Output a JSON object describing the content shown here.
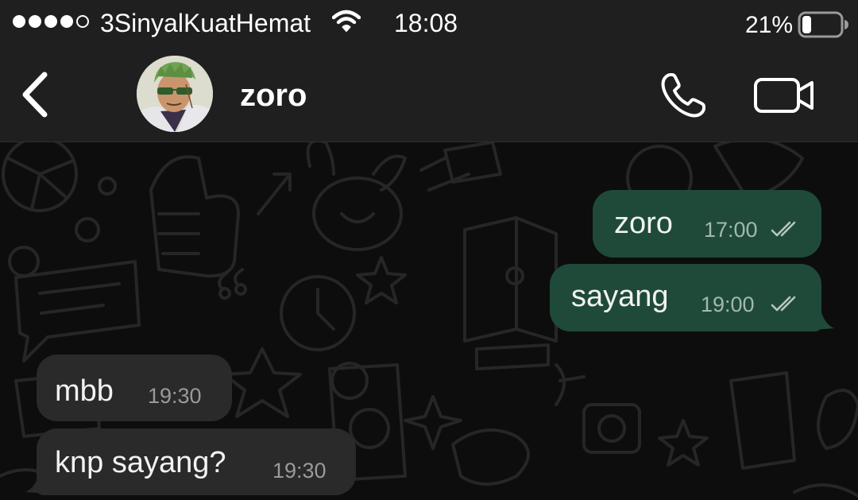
{
  "status_bar": {
    "carrier": "3SinyalKuatHemat",
    "time": "18:08",
    "battery_percent": "21%",
    "battery_level": 0.21,
    "signal_bars": 4,
    "signal_max": 5,
    "icons": [
      "signal-dots",
      "wifi-icon",
      "battery-icon"
    ]
  },
  "header": {
    "contact_name": "zoro",
    "icons": [
      "back-chevron-icon",
      "avatar",
      "phone-icon",
      "video-camera-icon"
    ]
  },
  "messages": [
    {
      "direction": "outgoing",
      "text": "zoro",
      "time": "17:00",
      "status": "read-double-tick"
    },
    {
      "direction": "outgoing",
      "text": "sayang",
      "time": "19:00",
      "status": "read-double-tick"
    },
    {
      "direction": "incoming",
      "text": "mbb",
      "time": "19:30"
    },
    {
      "direction": "incoming",
      "text": "knp sayang?",
      "time": "19:30"
    }
  ],
  "colors": {
    "bar_background": "#1f1f1f",
    "chat_background": "#0d0d0d",
    "outgoing_bubble": "#1f4a39",
    "incoming_bubble": "#2a2a2a",
    "text": "#ffffff"
  }
}
